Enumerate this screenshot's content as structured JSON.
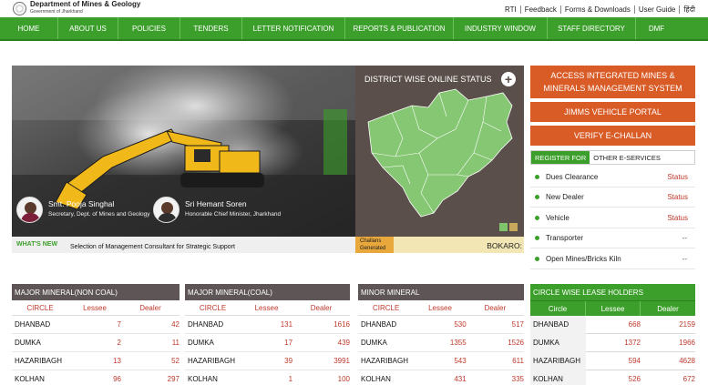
{
  "header": {
    "dept_title": "Department of Mines & Geology",
    "dept_subtitle": "Government of Jharkhand",
    "top_links": [
      "RTI",
      "Feedback",
      "Forms & Downloads",
      "User Guide",
      "हिंदी"
    ]
  },
  "nav": {
    "items": [
      "HOME",
      "ABOUT US",
      "POLICIES",
      "TENDERS",
      "LETTER NOTIFICATION",
      "REPORTS & PUBLICATION",
      "INDUSTRY WINDOW",
      "STAFF DIRECTORY",
      "DMF"
    ]
  },
  "hero": {
    "person1": {
      "name": "Smt. Pooja Singhal",
      "title": "Secretary, Dept. of Mines and Geology"
    },
    "person2": {
      "name": "Sri Hemant Soren",
      "title": "Honorable Chief Minister, Jharkhand"
    }
  },
  "map": {
    "title": "DISTRICT WISE ONLINE STATUS",
    "plus": "+",
    "accent_colors": [
      "#7fc36b",
      "#c8a85a"
    ]
  },
  "whats_new": {
    "label": "WHAT'S NEW",
    "text": "Selection of Management Consultant for Strategic Support"
  },
  "challans": {
    "label": "Challans Generated",
    "value": "BOKARO:"
  },
  "right_buttons": [
    "ACCESS INTEGRATED MINES & MINERALS MANAGEMENT SYSTEM",
    "JIMMS VEHICLE PORTAL",
    "VERIFY E-CHALLAN"
  ],
  "eservices": {
    "tab_register": "REGISTER FOR",
    "tab_other": "OTHER E-SERVICES",
    "rows": [
      {
        "label": "Dues Clearance",
        "status": "Status"
      },
      {
        "label": "New Dealer",
        "status": "Status"
      },
      {
        "label": "Vehicle",
        "status": "Status"
      },
      {
        "label": "Transporter",
        "status": "--"
      },
      {
        "label": "Open Mines/Bricks Kiln",
        "status": "--"
      }
    ]
  },
  "tables": [
    {
      "title": "MAJOR MINERAL(NON COAL)",
      "headers": [
        "Circle",
        "Lessee",
        "Dealer"
      ],
      "rows": [
        [
          "DHANBAD",
          "7",
          "42"
        ],
        [
          "DUMKA",
          "2",
          "11"
        ],
        [
          "HAZARIBAGH",
          "13",
          "52"
        ],
        [
          "KOLHAN",
          "96",
          "297"
        ]
      ]
    },
    {
      "title": "MAJOR MINERAL(COAL)",
      "headers": [
        "Circle",
        "Lessee",
        "Dealer"
      ],
      "rows": [
        [
          "DHANBAD",
          "131",
          "1616"
        ],
        [
          "DUMKA",
          "17",
          "439"
        ],
        [
          "HAZARIBAGH",
          "39",
          "3991"
        ],
        [
          "KOLHAN",
          "1",
          "100"
        ]
      ]
    },
    {
      "title": "MINOR MINERAL",
      "headers": [
        "Circle",
        "Lessee",
        "Dealer"
      ],
      "rows": [
        [
          "DHANBAD",
          "530",
          "517"
        ],
        [
          "DUMKA",
          "1355",
          "1526"
        ],
        [
          "HAZARIBAGH",
          "543",
          "611"
        ],
        [
          "KOLHAN",
          "431",
          "335"
        ]
      ]
    }
  ],
  "lease": {
    "title": "CIRCLE WISE LEASE HOLDERS",
    "headers": [
      "Circle",
      "Lessee",
      "Dealer"
    ],
    "rows": [
      [
        "DHANBAD",
        "668",
        "2159"
      ],
      [
        "DUMKA",
        "1372",
        "1966"
      ],
      [
        "HAZARIBAGH",
        "594",
        "4628"
      ],
      [
        "KOLHAN",
        "526",
        "672"
      ]
    ]
  }
}
